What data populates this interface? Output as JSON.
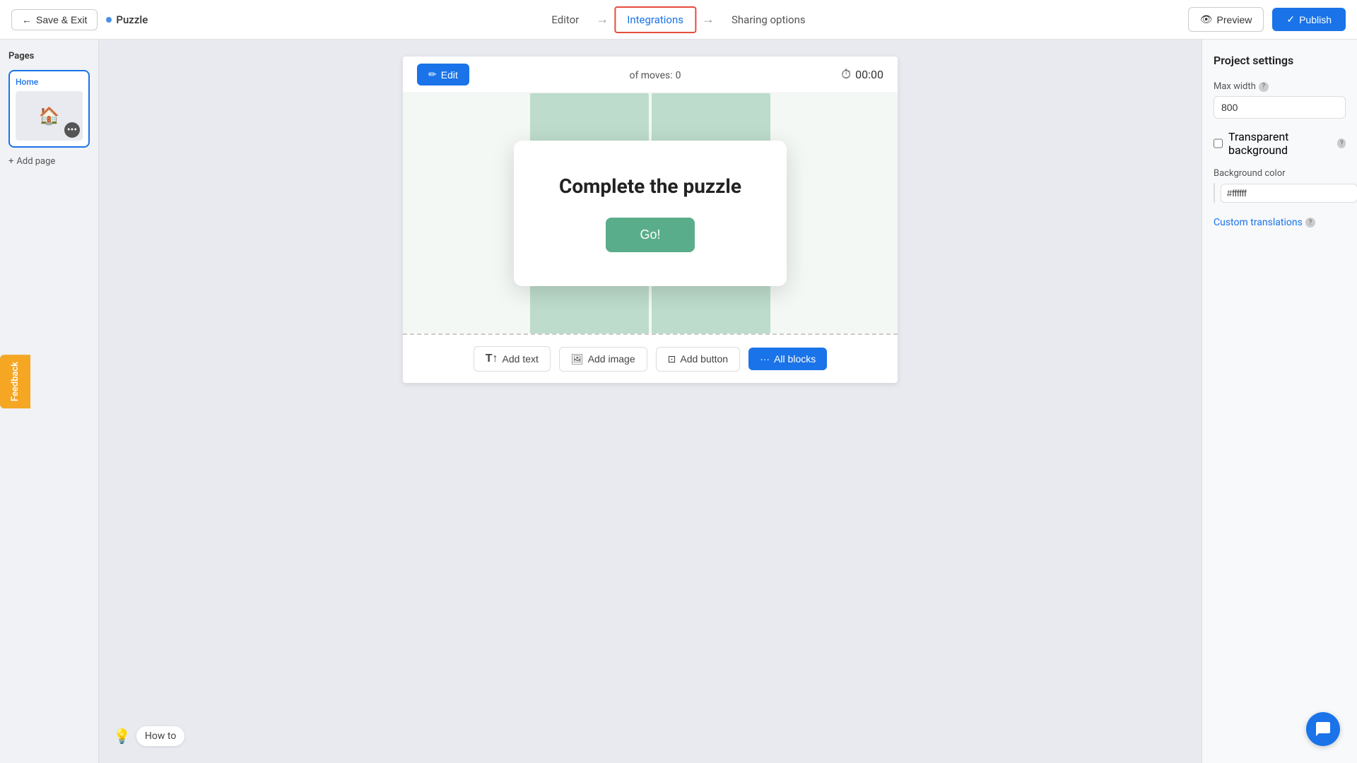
{
  "nav": {
    "save_exit_label": "Save & Exit",
    "project_name": "Puzzle",
    "tabs": [
      {
        "id": "editor",
        "label": "Editor",
        "active": false
      },
      {
        "id": "integrations",
        "label": "Integrations",
        "active": true
      },
      {
        "id": "sharing",
        "label": "Sharing options",
        "active": false
      }
    ],
    "preview_label": "Preview",
    "publish_label": "Publish"
  },
  "sidebar": {
    "title": "Pages",
    "pages": [
      {
        "id": "home",
        "label": "Home"
      }
    ],
    "add_page_label": "Add page"
  },
  "canvas": {
    "edit_label": "Edit",
    "moves_label": "of moves:",
    "moves_count": "0",
    "timer": "00:00",
    "modal": {
      "title": "Complete the puzzle",
      "go_label": "Go!"
    },
    "bottom_toolbar": {
      "add_text_label": "Add text",
      "add_image_label": "Add image",
      "add_button_label": "Add button",
      "all_blocks_label": "All blocks"
    }
  },
  "settings": {
    "title": "Project settings",
    "max_width_label": "Max width",
    "max_width_help": "?",
    "max_width_value": "800",
    "transparent_bg_label": "Transparent background",
    "transparent_bg_help": "?",
    "bg_color_label": "Background color",
    "bg_color_value": "#ffffff",
    "custom_translations_label": "Custom translations",
    "custom_translations_help": "?"
  },
  "feedback": {
    "label": "Feedback"
  },
  "how_to": {
    "label": "How to"
  },
  "icons": {
    "arrow_left": "←",
    "arrow_right": "→",
    "eye": "👁",
    "check": "✓",
    "edit_pencil": "✏",
    "timer_clock": "⏱",
    "plus": "+",
    "more_dots": "···",
    "text_icon": "T",
    "image_icon": "🖼",
    "button_icon": "⊡",
    "blocks_icon": "···",
    "chat_icon": "💬",
    "bulb_icon": "💡"
  }
}
